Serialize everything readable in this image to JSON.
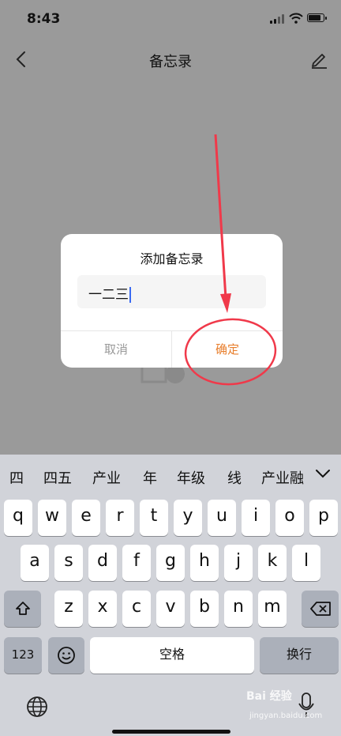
{
  "status_bar": {
    "time": "8:43"
  },
  "nav": {
    "title": "备忘录"
  },
  "dialog": {
    "title": "添加备忘录",
    "input_value": "一二三",
    "cancel_label": "取消",
    "confirm_label": "确定"
  },
  "colors": {
    "confirm": "#e87e2c",
    "annotation": "#f0394a",
    "caret": "#3b6bf2"
  },
  "keyboard": {
    "candidates": [
      "四",
      "四五",
      "产业",
      "年",
      "年级",
      "线",
      "产业融"
    ],
    "row1": [
      "q",
      "w",
      "e",
      "r",
      "t",
      "y",
      "u",
      "i",
      "o",
      "p"
    ],
    "row2": [
      "a",
      "s",
      "d",
      "f",
      "g",
      "h",
      "j",
      "k",
      "l"
    ],
    "row3": [
      "z",
      "x",
      "c",
      "v",
      "b",
      "n",
      "m"
    ],
    "numbers_label": "123",
    "space_label": "空格",
    "return_label": "换行"
  },
  "watermark": {
    "brand": "Bai 经验",
    "url": "jingyan.baidu.com"
  }
}
